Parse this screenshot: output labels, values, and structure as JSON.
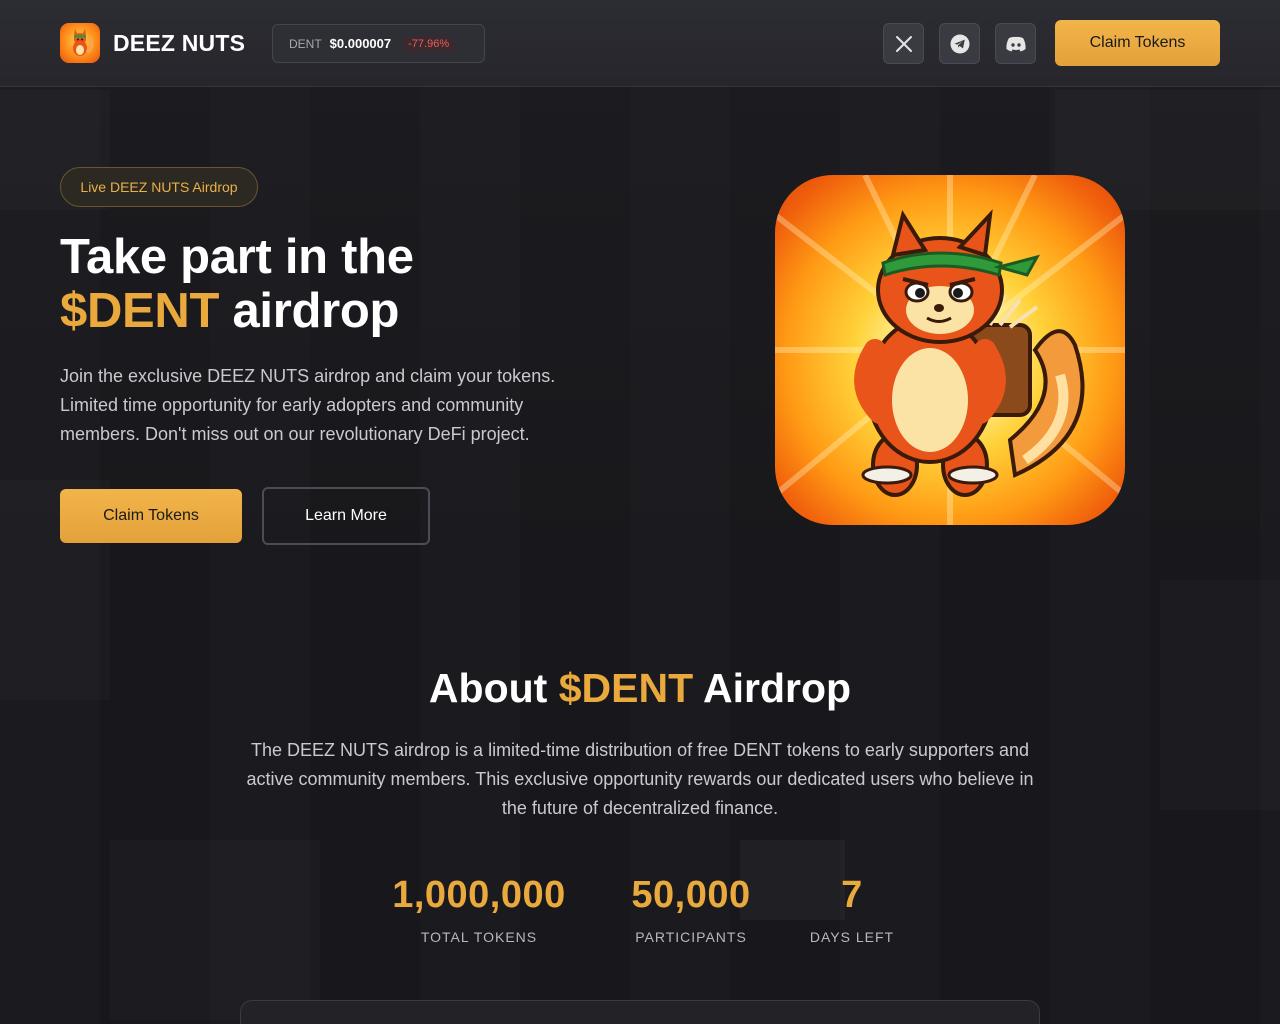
{
  "header": {
    "brand": "DEEZ NUTS",
    "price": {
      "ticker": "DENT",
      "value": "$0.000007",
      "change": "-77.96%"
    },
    "social": [
      {
        "name": "x-icon"
      },
      {
        "name": "telegram-icon"
      },
      {
        "name": "discord-icon"
      }
    ],
    "cta_label": "Claim Tokens"
  },
  "hero": {
    "badge": "Live DEEZ NUTS Airdrop",
    "title_line1": "Take part in the",
    "title_accent": "$DENT",
    "title_line2_rest": " airdrop",
    "description": "Join the exclusive DEEZ NUTS airdrop and claim your tokens. Limited time opportunity for early adopters and community members. Don't miss out on our revolutionary DeFi project.",
    "primary_button": "Claim Tokens",
    "secondary_button": "Learn More"
  },
  "about": {
    "title_prefix": "About ",
    "title_accent": "$DENT",
    "title_suffix": " Airdrop",
    "description": "The DEEZ NUTS airdrop is a limited-time distribution of free DENT tokens to early supporters and active community members. This exclusive opportunity rewards our dedicated users who believe in the future of decentralized finance.",
    "stats": [
      {
        "value": "1,000,000",
        "label": "TOTAL TOKENS"
      },
      {
        "value": "50,000",
        "label": "PARTICIPANTS"
      },
      {
        "value": "7",
        "label": "DAYS LEFT"
      }
    ]
  },
  "colors": {
    "accent": "#e9a93d",
    "background": "#18181c",
    "negative": "#ef5b5b"
  }
}
